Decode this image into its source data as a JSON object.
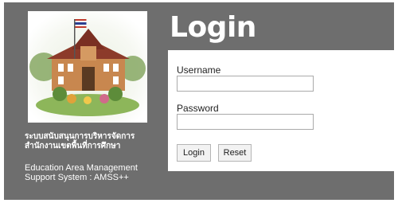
{
  "title": "Login",
  "org": {
    "thai_line1": "ระบบสนับสนุนการบริหารจัดการ",
    "thai_line2": "สำนักงานเขตพื้นที่การศึกษา",
    "english_line1": "Education Area Management",
    "english_line2": "Support System : AMSS++"
  },
  "form": {
    "username_label": "Username",
    "username_value": "",
    "password_label": "Password",
    "password_value": "",
    "login_button": "Login",
    "reset_button": "Reset"
  },
  "colors": {
    "panel_bg": "#6e6e6e",
    "form_bg": "#ffffff",
    "title_text": "#ffffff"
  }
}
